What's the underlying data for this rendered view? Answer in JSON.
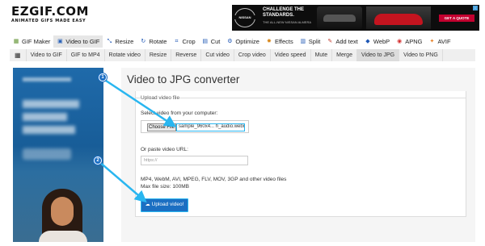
{
  "logo": {
    "main": "EZGIF.COM",
    "tagline": "ANIMATED GIFS MADE EASY"
  },
  "ad": {
    "brand": "NISSAN",
    "headline": "CHALLENGE THE STANDARDS.",
    "subline": "THE ALL-NEW NISSAN ALMERA",
    "cta": "GET A QUOTE",
    "badge": "i"
  },
  "nav": {
    "items": [
      {
        "label": "GIF Maker",
        "icon": "gif-maker-icon",
        "glyph": "▦",
        "color": "#5b8f2b"
      },
      {
        "label": "Video to GIF",
        "icon": "video-to-gif-icon",
        "glyph": "▣",
        "color": "#2b62b8",
        "active": true
      },
      {
        "label": "Resize",
        "icon": "resize-icon",
        "glyph": "⤡",
        "color": "#1e57b5"
      },
      {
        "label": "Rotate",
        "icon": "rotate-icon",
        "glyph": "↻",
        "color": "#1e57b5"
      },
      {
        "label": "Crop",
        "icon": "crop-icon",
        "glyph": "⌗",
        "color": "#1e57b5"
      },
      {
        "label": "Cut",
        "icon": "cut-icon",
        "glyph": "▤",
        "color": "#1e57b5"
      },
      {
        "label": "Optimize",
        "icon": "optimize-icon",
        "glyph": "⚙",
        "color": "#1e57b5"
      },
      {
        "label": "Effects",
        "icon": "effects-icon",
        "glyph": "✸",
        "color": "#d98a1f"
      },
      {
        "label": "Split",
        "icon": "split-icon",
        "glyph": "▥",
        "color": "#1e57b5"
      },
      {
        "label": "Add text",
        "icon": "add-text-icon",
        "glyph": "✎",
        "color": "#c0392b"
      },
      {
        "label": "WebP",
        "icon": "webp-icon",
        "glyph": "◆",
        "color": "#1e57b5"
      },
      {
        "label": "APNG",
        "icon": "apng-icon",
        "glyph": "◉",
        "color": "#d32f2f"
      },
      {
        "label": "AVIF",
        "icon": "avif-icon",
        "glyph": "✦",
        "color": "#e67e22"
      }
    ]
  },
  "subnav": {
    "items": [
      {
        "label": "Video to GIF"
      },
      {
        "label": "GIF to MP4"
      },
      {
        "label": "Rotate video"
      },
      {
        "label": "Resize"
      },
      {
        "label": "Reverse"
      },
      {
        "label": "Cut video"
      },
      {
        "label": "Crop video"
      },
      {
        "label": "Video speed"
      },
      {
        "label": "Mute"
      },
      {
        "label": "Merge"
      },
      {
        "label": "Video to JPG",
        "active": true
      },
      {
        "label": "Video to PNG"
      }
    ]
  },
  "main": {
    "title": "Video to JPG converter",
    "upload_legend": "Upload video file",
    "select_label": "Select video from your computer:",
    "choose_file": "Choose File",
    "file_name": "sample_960x4... h_audio.webm",
    "paste_label": "Or paste video URL:",
    "url_placeholder": "https://",
    "formats_text": "MP4, WebM, AVI, MPEG, FLV, MOV, 3GP and other video files",
    "max_size_text": "Max file size: 100MB",
    "upload_button": "Upload video!"
  },
  "callouts": {
    "one": "1",
    "two": "2"
  },
  "accent_color": "#29b6f0",
  "button_color": "#1b6fc2"
}
